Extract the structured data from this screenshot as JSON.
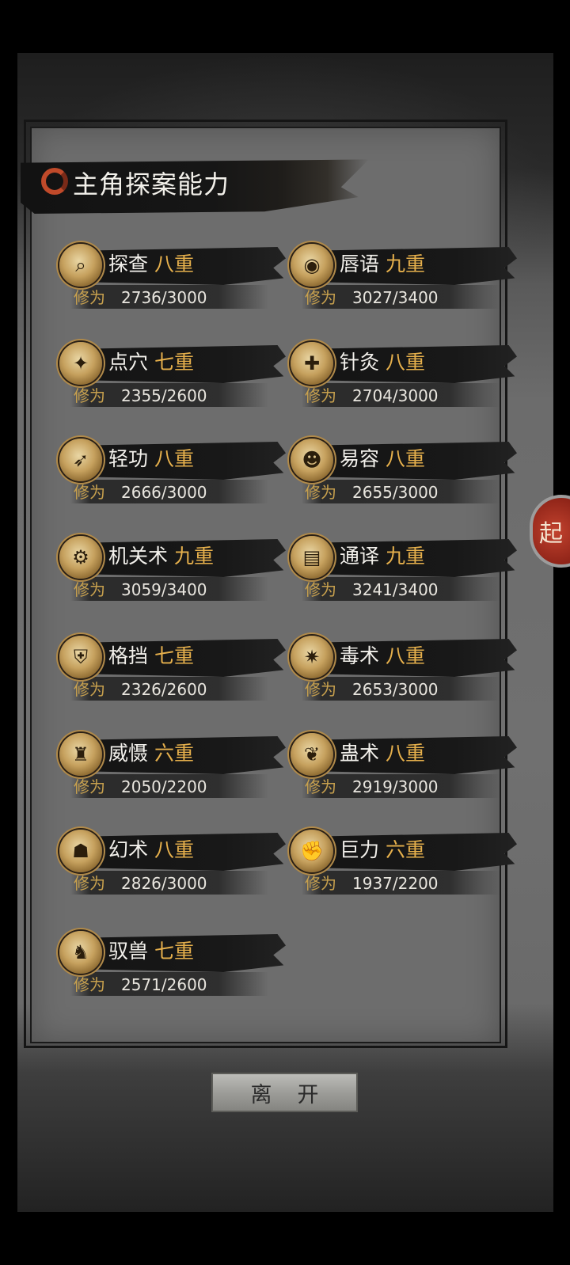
{
  "title": "主角探案能力",
  "label_prefix": "修为",
  "left_column": [
    {
      "name": "探查",
      "rank": "八重",
      "value": "2736/3000"
    },
    {
      "name": "点穴",
      "rank": "七重",
      "value": "2355/2600"
    },
    {
      "name": "轻功",
      "rank": "八重",
      "value": "2666/3000"
    },
    {
      "name": "机关术",
      "rank": "九重",
      "value": "3059/3400"
    },
    {
      "name": "格挡",
      "rank": "七重",
      "value": "2326/2600"
    },
    {
      "name": "威慑",
      "rank": "六重",
      "value": "2050/2200"
    },
    {
      "name": "幻术",
      "rank": "八重",
      "value": "2826/3000"
    },
    {
      "name": "驭兽",
      "rank": "七重",
      "value": "2571/2600"
    }
  ],
  "right_column": [
    {
      "name": "唇语",
      "rank": "九重",
      "value": "3027/3400"
    },
    {
      "name": "针灸",
      "rank": "八重",
      "value": "2704/3000"
    },
    {
      "name": "易容",
      "rank": "八重",
      "value": "2655/3000"
    },
    {
      "name": "通译",
      "rank": "九重",
      "value": "3241/3400"
    },
    {
      "name": "毒术",
      "rank": "八重",
      "value": "2653/3000"
    },
    {
      "name": "蛊术",
      "rank": "八重",
      "value": "2919/3000"
    },
    {
      "name": "巨力",
      "rank": "六重",
      "value": "1937/2200"
    }
  ],
  "leave_button": "离开",
  "side_button": "起",
  "colors": {
    "rank": "#e6b04c",
    "label": "#c8a14e",
    "accent_logo": "#c04a2a"
  }
}
